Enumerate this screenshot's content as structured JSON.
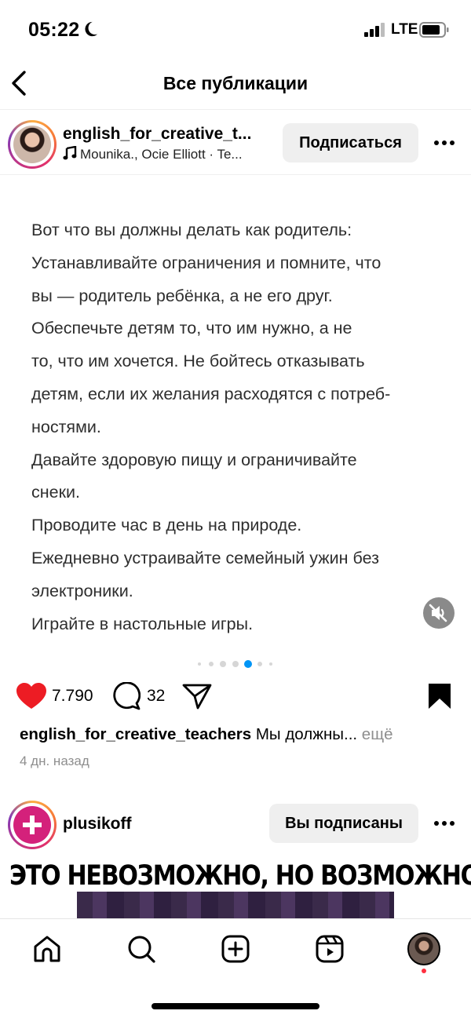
{
  "status_bar": {
    "time": "05:22",
    "network": "LTE"
  },
  "header": {
    "title": "Все публикации"
  },
  "post1": {
    "username": "english_for_creative_t...",
    "music": "Mounika., Ocie Elliott · Te...",
    "follow_label": "Подписаться",
    "text_lines": [
      "Вот что вы должны делать как родитель:",
      "Устанавливайте ограничения и помните, что",
      "вы — родитель ребёнка, а не его друг.",
      "Обеспечьте детям то, что им нужно, а не",
      "то, что им хочется. Не бойтесь отказывать",
      "детям, если их желания расходятся с потреб-",
      "ностями.",
      "Давайте здоровую пищу и ограничивайте",
      "снеки.",
      "Проводите час в день на природе.",
      "Ежедневно устраивайте семейный ужин без",
      "электроники.",
      "Играйте в настольные игры."
    ],
    "carousel": {
      "total": 7,
      "active_index": 4
    },
    "likes": "7.790",
    "comments": "32",
    "caption_user": "english_for_creative_teachers",
    "caption_text": "Мы должны...",
    "caption_more": "ещё",
    "time_ago": "4 дн. назад"
  },
  "post2": {
    "username": "plusikoff",
    "following_label": "Вы подписаны",
    "banner_text": "ЭТО НЕВОЗМОЖНО, НО ВОЗМОЖНО😳👏"
  },
  "tabs": [
    {
      "name": "home-icon"
    },
    {
      "name": "search-icon"
    },
    {
      "name": "create-icon"
    },
    {
      "name": "reels-icon"
    },
    {
      "name": "profile-avatar"
    }
  ],
  "colors": {
    "like": "#ed1c24",
    "active_dot": "#0095f6",
    "notification": "#ff3040"
  }
}
